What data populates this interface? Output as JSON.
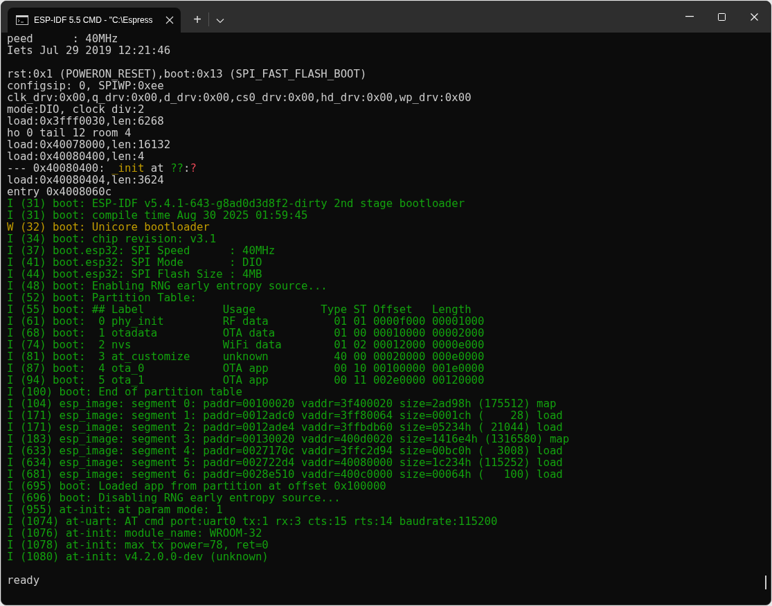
{
  "window": {
    "tab": {
      "title": "ESP-IDF 5.5 CMD - \"C:\\Espress",
      "selected": true
    },
    "new_tab": "+"
  },
  "console": {
    "lines": [
      {
        "kind": "plain",
        "text": "peed      : 40MHz"
      },
      {
        "kind": "plain",
        "text": "Iets Jul 29 2019 12:21:46"
      },
      {
        "kind": "blank"
      },
      {
        "kind": "plain",
        "text": "rst:0x1 (POWERON_RESET),boot:0x13 (SPI_FAST_FLASH_BOOT)"
      },
      {
        "kind": "plain",
        "text": "configsip: 0, SPIWP:0xee"
      },
      {
        "kind": "plain",
        "text": "clk_drv:0x00,q_drv:0x00,d_drv:0x00,cs0_drv:0x00,hd_drv:0x00,wp_drv:0x00"
      },
      {
        "kind": "plain",
        "text": "mode:DIO, clock div:2"
      },
      {
        "kind": "plain",
        "text": "load:0x3fff0030,len:6268"
      },
      {
        "kind": "plain",
        "text": "ho 0 tail 12 room 4"
      },
      {
        "kind": "plain",
        "text": "load:0x40078000,len:16132"
      },
      {
        "kind": "plain",
        "text": "load:0x40080400,len:4"
      },
      {
        "kind": "mixed",
        "parts": [
          {
            "text": "--- 0x40080400: ",
            "color": "#cccccc"
          },
          {
            "text": "_init",
            "color": "#c19c00"
          },
          {
            "text": " at ",
            "color": "#cccccc"
          },
          {
            "text": "??",
            "color": "#13a10e"
          },
          {
            "text": ":",
            "color": "#cccccc"
          },
          {
            "text": "?",
            "color": "#e74856"
          }
        ]
      },
      {
        "kind": "plain",
        "text": "load:0x40080404,len:3624"
      },
      {
        "kind": "plain",
        "text": "entry 0x4008060c"
      },
      {
        "kind": "info",
        "text": "I (31) boot: ESP-IDF v5.4.1-643-g8ad0d3d8f2-dirty 2nd stage bootloader"
      },
      {
        "kind": "info",
        "text": "I (31) boot: compile time Aug 30 2025 01:59:45"
      },
      {
        "kind": "warn",
        "text": "W (32) boot: Unicore bootloader"
      },
      {
        "kind": "info",
        "text": "I (34) boot: chip revision: v3.1"
      },
      {
        "kind": "info",
        "text": "I (37) boot.esp32: SPI Speed      : 40MHz"
      },
      {
        "kind": "info",
        "text": "I (41) boot.esp32: SPI Mode       : DIO"
      },
      {
        "kind": "info",
        "text": "I (44) boot.esp32: SPI Flash Size : 4MB"
      },
      {
        "kind": "info",
        "text": "I (48) boot: Enabling RNG early entropy source..."
      },
      {
        "kind": "info",
        "text": "I (52) boot: Partition Table:"
      },
      {
        "kind": "info",
        "text": "I (55) boot: ## Label            Usage          Type ST Offset   Length"
      },
      {
        "kind": "info",
        "text": "I (61) boot:  0 phy_init         RF data          01 01 0000f000 00001000"
      },
      {
        "kind": "info",
        "text": "I (68) boot:  1 otadata          OTA data         01 00 00010000 00002000"
      },
      {
        "kind": "info",
        "text": "I (74) boot:  2 nvs              WiFi data        01 02 00012000 0000e000"
      },
      {
        "kind": "info",
        "text": "I (81) boot:  3 at_customize     unknown          40 00 00020000 000e0000"
      },
      {
        "kind": "info",
        "text": "I (87) boot:  4 ota_0            OTA app          00 10 00100000 001e0000"
      },
      {
        "kind": "info",
        "text": "I (94) boot:  5 ota_1            OTA app          00 11 002e0000 00120000"
      },
      {
        "kind": "info",
        "text": "I (100) boot: End of partition table"
      },
      {
        "kind": "info",
        "text": "I (104) esp_image: segment 0: paddr=00100020 vaddr=3f400020 size=2ad98h (175512) map"
      },
      {
        "kind": "info",
        "text": "I (171) esp_image: segment 1: paddr=0012adc0 vaddr=3ff80064 size=0001ch (    28) load"
      },
      {
        "kind": "info",
        "text": "I (171) esp_image: segment 2: paddr=0012ade4 vaddr=3ffbdb60 size=05234h ( 21044) load"
      },
      {
        "kind": "info",
        "text": "I (183) esp_image: segment 3: paddr=00130020 vaddr=400d0020 size=1416e4h (1316580) map"
      },
      {
        "kind": "info",
        "text": "I (633) esp_image: segment 4: paddr=0027170c vaddr=3ffc2d94 size=00bc0h (  3008) load"
      },
      {
        "kind": "info",
        "text": "I (634) esp_image: segment 5: paddr=002722d4 vaddr=40080000 size=1c234h (115252) load"
      },
      {
        "kind": "info",
        "text": "I (681) esp_image: segment 6: paddr=0028e510 vaddr=400c0000 size=00064h (   100) load"
      },
      {
        "kind": "info",
        "text": "I (695) boot: Loaded app from partition at offset 0x100000"
      },
      {
        "kind": "info",
        "text": "I (696) boot: Disabling RNG early entropy source..."
      },
      {
        "kind": "info",
        "text": "I (955) at-init: at param mode: 1"
      },
      {
        "kind": "info",
        "text": "I (1074) at-uart: AT cmd port:uart0 tx:1 rx:3 cts:15 rts:14 baudrate:115200"
      },
      {
        "kind": "info",
        "text": "I (1076) at-init: module_name: WROOM-32"
      },
      {
        "kind": "info",
        "text": "I (1078) at-init: max tx power=78, ret=0"
      },
      {
        "kind": "info",
        "text": "I (1080) at-init: v4.2.0.0-dev (unknown)"
      },
      {
        "kind": "blank"
      },
      {
        "kind": "plain",
        "text": "ready"
      }
    ]
  }
}
